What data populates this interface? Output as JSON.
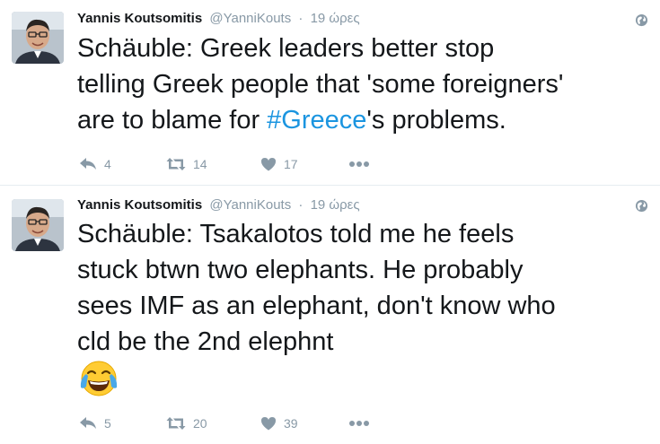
{
  "tweets": [
    {
      "fullname": "Yannis Koutsomitis",
      "username": "@YanniKouts",
      "dot": "·",
      "time": "19 ώρες",
      "text_lines": [
        "Schäuble: Greek leaders better stop",
        "telling Greek people that 'some foreigners'"
      ],
      "line3_before": "are to blame for ",
      "hashtag": "#Greece",
      "line3_after": "'s problems.",
      "replies": "4",
      "retweets": "14",
      "likes": "17"
    },
    {
      "fullname": "Yannis Koutsomitis",
      "username": "@YanniKouts",
      "dot": "·",
      "time": "19 ώρες",
      "text_lines": [
        "Schäuble: Tsakalotos told me he feels",
        "stuck btwn two elephants. He probably",
        "sees IMF as an elephant, don't know who",
        "cld be the 2nd elephnt"
      ],
      "emoji": "face-with-tears-of-joy",
      "replies": "5",
      "retweets": "20",
      "likes": "39"
    }
  ],
  "icons": {
    "reply": "reply-icon",
    "retweet": "retweet-icon",
    "like": "heart-icon",
    "more": "more-dots-icon",
    "globe": "globe-icon"
  },
  "colors": {
    "hashtag": "#1b95e0",
    "meta": "#8899a6",
    "text": "#14171a"
  }
}
